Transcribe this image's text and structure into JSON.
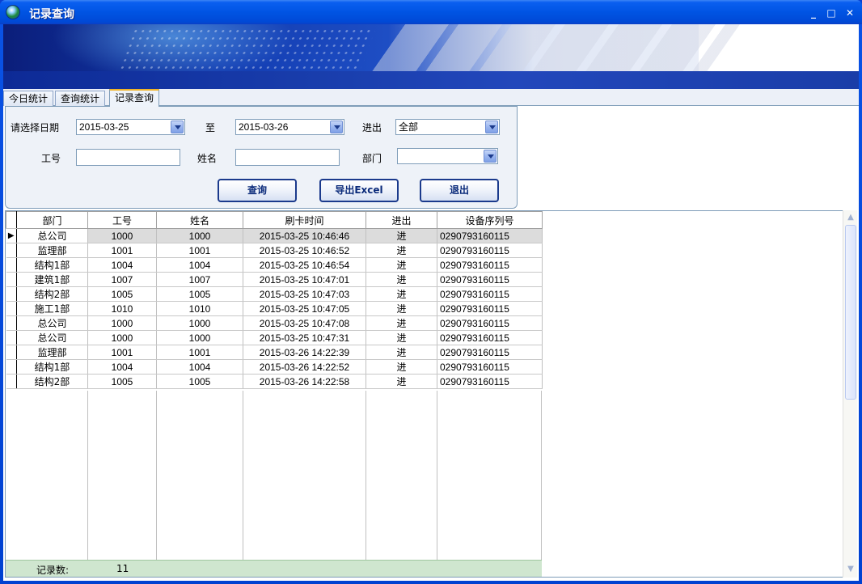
{
  "window": {
    "title": "记录查询",
    "minimize_glyph": "_",
    "maximize_glyph": "□",
    "close_glyph": "✕"
  },
  "tabs": [
    {
      "label": "今日统计",
      "active": false
    },
    {
      "label": "查询统计",
      "active": false
    },
    {
      "label": "记录查询",
      "active": true
    }
  ],
  "filters": {
    "date_label": "请选择日期",
    "date_from": "2015-03-25",
    "to_label": "至",
    "date_to": "2015-03-26",
    "inout_label": "进出",
    "inout_value": "全部",
    "id_label": "工号",
    "id_value": "",
    "name_label": "姓名",
    "name_value": "",
    "dept_label": "部门",
    "dept_value": ""
  },
  "buttons": {
    "query": "查询",
    "export": "导出Excel",
    "exit": "退出"
  },
  "table": {
    "columns": [
      "部门",
      "工号",
      "姓名",
      "刷卡时间",
      "进出",
      "设备序列号"
    ],
    "rows": [
      [
        "总公司",
        "1000",
        "1000",
        "2015-03-25 10:46:46",
        "进",
        "0290793160115"
      ],
      [
        "监理部",
        "1001",
        "1001",
        "2015-03-25 10:46:52",
        "进",
        "0290793160115"
      ],
      [
        "结构1部",
        "1004",
        "1004",
        "2015-03-25 10:46:54",
        "进",
        "0290793160115"
      ],
      [
        "建筑1部",
        "1007",
        "1007",
        "2015-03-25 10:47:01",
        "进",
        "0290793160115"
      ],
      [
        "结构2部",
        "1005",
        "1005",
        "2015-03-25 10:47:03",
        "进",
        "0290793160115"
      ],
      [
        "施工1部",
        "1010",
        "1010",
        "2015-03-25 10:47:05",
        "进",
        "0290793160115"
      ],
      [
        "总公司",
        "1000",
        "1000",
        "2015-03-25 10:47:08",
        "进",
        "0290793160115"
      ],
      [
        "总公司",
        "1000",
        "1000",
        "2015-03-25 10:47:31",
        "进",
        "0290793160115"
      ],
      [
        "监理部",
        "1001",
        "1001",
        "2015-03-26 14:22:39",
        "进",
        "0290793160115"
      ],
      [
        "结构1部",
        "1004",
        "1004",
        "2015-03-26 14:22:52",
        "进",
        "0290793160115"
      ],
      [
        "结构2部",
        "1005",
        "1005",
        "2015-03-26 14:22:58",
        "进",
        "0290793160115"
      ]
    ],
    "summary_label": "记录数:",
    "summary_count": "11",
    "selected_row_marker": "▶"
  },
  "scrollbar": {
    "up_glyph": "▲",
    "down_glyph": "▼"
  }
}
